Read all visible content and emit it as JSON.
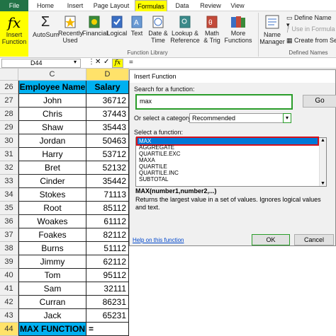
{
  "tabs": {
    "file": "File",
    "home": "Home",
    "insert": "Insert",
    "page_layout": "Page Layout",
    "formulas": "Formulas",
    "data": "Data",
    "review": "Review",
    "view": "View"
  },
  "ribbon": {
    "insert_function": [
      "Insert",
      "Function"
    ],
    "autosum": "AutoSum",
    "recently_used": [
      "Recently",
      "Used"
    ],
    "financial": "Financial",
    "logical": "Logical",
    "text": "Text",
    "date_time": [
      "Date &",
      "Time"
    ],
    "lookup": [
      "Lookup &",
      "Reference"
    ],
    "math": [
      "Math",
      "& Trig"
    ],
    "more": [
      "More",
      "Functions"
    ],
    "name_manager": [
      "Name",
      "Manager"
    ],
    "define_name": "Define Name",
    "use_in_formula": "Use in Formula",
    "create_from_sel": "Create from Sele",
    "group_library": "Function Library",
    "group_defined": "Defined Names"
  },
  "formula_bar": {
    "name_box": "D44",
    "fx": "fx",
    "content": "="
  },
  "columns": {
    "c": "C",
    "d": "D"
  },
  "rows": [
    {
      "n": "26",
      "name": "Employee Name",
      "salary": "Salary"
    },
    {
      "n": "27",
      "name": "John",
      "salary": "36712"
    },
    {
      "n": "28",
      "name": "Chris",
      "salary": "37443"
    },
    {
      "n": "29",
      "name": "Shaw",
      "salary": "35443"
    },
    {
      "n": "30",
      "name": "Jordan",
      "salary": "50463"
    },
    {
      "n": "31",
      "name": "Harry",
      "salary": "53712"
    },
    {
      "n": "32",
      "name": "Bret",
      "salary": "52132"
    },
    {
      "n": "33",
      "name": "Cinder",
      "salary": "35442"
    },
    {
      "n": "34",
      "name": "Stokes",
      "salary": "71113"
    },
    {
      "n": "35",
      "name": "Root",
      "salary": "85112"
    },
    {
      "n": "36",
      "name": "Woakes",
      "salary": "61112"
    },
    {
      "n": "37",
      "name": "Foakes",
      "salary": "82112"
    },
    {
      "n": "38",
      "name": "Burns",
      "salary": "51112"
    },
    {
      "n": "39",
      "name": "Jimmy",
      "salary": "62112"
    },
    {
      "n": "40",
      "name": "Tom",
      "salary": "95112"
    },
    {
      "n": "41",
      "name": "Sam",
      "salary": "32111"
    },
    {
      "n": "42",
      "name": "Curran",
      "salary": "86231"
    },
    {
      "n": "43",
      "name": "Jack",
      "salary": "65231"
    },
    {
      "n": "44",
      "name": "MAX FUNCTION",
      "salary": "="
    }
  ],
  "dialog": {
    "title": "Insert Function",
    "search_label": "Search for a function:",
    "search_value": "max",
    "go": "Go",
    "category_label": "Or select a category:",
    "category_value": "Recommended",
    "select_label": "Select a function:",
    "functions": [
      "MAX",
      "AGGREGATE",
      "QUARTILE.EXC",
      "MAXA",
      "QUARTILE",
      "QUARTILE.INC",
      "SUBTOTAL"
    ],
    "signature": "MAX(number1,number2,...)",
    "description": "Returns the largest value in a set of values. Ignores logical values and text.",
    "help": "Help on this function",
    "ok": "OK",
    "cancel": "Cancel"
  },
  "colors": {
    "accent_yellow": "#ffff00",
    "header_blue": "#00b0f0",
    "excel_green": "#217346",
    "selection_blue": "#0078d7",
    "highlight_red": "#d8101a"
  }
}
